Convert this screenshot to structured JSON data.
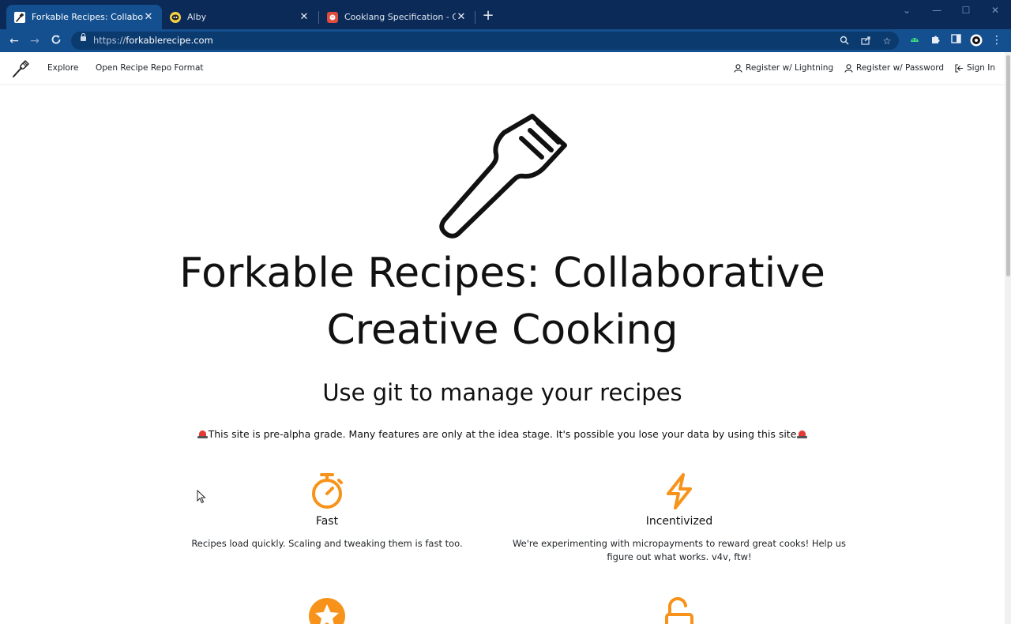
{
  "browser": {
    "tabs": [
      {
        "title": "Forkable Recipes: Collaborative C",
        "active": true,
        "favicon": "fork-icon"
      },
      {
        "title": "Alby",
        "active": false,
        "favicon": "alby-bee-icon"
      },
      {
        "title": "Cooklang Specification - Cooklan",
        "active": false,
        "favicon": "cooklang-icon"
      }
    ],
    "new_tab_label": "+",
    "url_scheme": "https://",
    "url_host": "forkablerecipe.com"
  },
  "nav": {
    "explore": "Explore",
    "open_format": "Open Recipe Repo Format",
    "register_lightning": "Register w/ Lightning",
    "register_password": "Register w/ Password",
    "sign_in": "Sign In"
  },
  "hero": {
    "title_line1": "Forkable Recipes: Collaborative",
    "title_line2": "Creative Cooking",
    "subtitle": "Use git to manage your recipes",
    "warning": "This site is pre-alpha grade. Many features are only at the idea stage. It's possible you lose your data by using this site"
  },
  "features": [
    {
      "icon": "stopwatch-icon",
      "title": "Fast",
      "description": "Recipes load quickly. Scaling and tweaking them is fast too."
    },
    {
      "icon": "lightning-icon",
      "title": "Incentivized",
      "description_line1": "We're experimenting with micropayments to reward great cooks! Help us",
      "description_line2": "figure out what works. v4v, ftw!"
    },
    {
      "icon": "star-icon"
    },
    {
      "icon": "unlock-icon"
    }
  ],
  "colors": {
    "accent": "#f7931a",
    "chrome_dark": "#0b2a57",
    "chrome_toolbar": "#14508f"
  }
}
